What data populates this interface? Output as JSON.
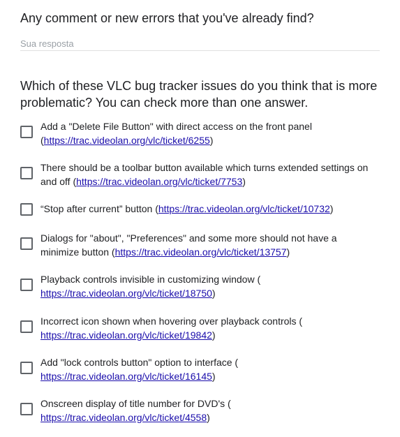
{
  "question1": {
    "text": "Any comment or new errors that you've already find?",
    "placeholder": "Sua resposta"
  },
  "question2": {
    "text": "Which of these VLC bug tracker issues do you think that is more problematic? You can check more than one answer."
  },
  "options": [
    {
      "text": "Add a \"Delete File Button\" with direct access on the front panel (",
      "link": "https://trac.videolan.org/vlc/ticket/6255",
      "suffix": ")"
    },
    {
      "text": "There should be a toolbar button available which turns extended settings on and off (",
      "link": "https://trac.videolan.org/vlc/ticket/7753",
      "suffix": ")"
    },
    {
      "text": "“Stop after current” button (",
      "link": "https://trac.videolan.org/vlc/ticket/10732",
      "suffix": ")"
    },
    {
      "text": "Dialogs for \"about\", \"Preferences\" and some more should not have a minimize button (",
      "link": "https://trac.videolan.org/vlc/ticket/13757",
      "suffix": ")"
    },
    {
      "text": "Playback controls invisible in customizing window (",
      "link": "https://trac.videolan.org/vlc/ticket/18750",
      "suffix": ")"
    },
    {
      "text": "Incorrect icon shown when hovering over playback controls (",
      "link": "https://trac.videolan.org/vlc/ticket/19842",
      "suffix": ")"
    },
    {
      "text": "Add \"lock controls button\" option to interface (",
      "link": "https://trac.videolan.org/vlc/ticket/16145",
      "suffix": ")"
    },
    {
      "text": "Onscreen display of title number for DVD's (",
      "link": "https://trac.videolan.org/vlc/ticket/4558",
      "suffix": ")"
    }
  ]
}
